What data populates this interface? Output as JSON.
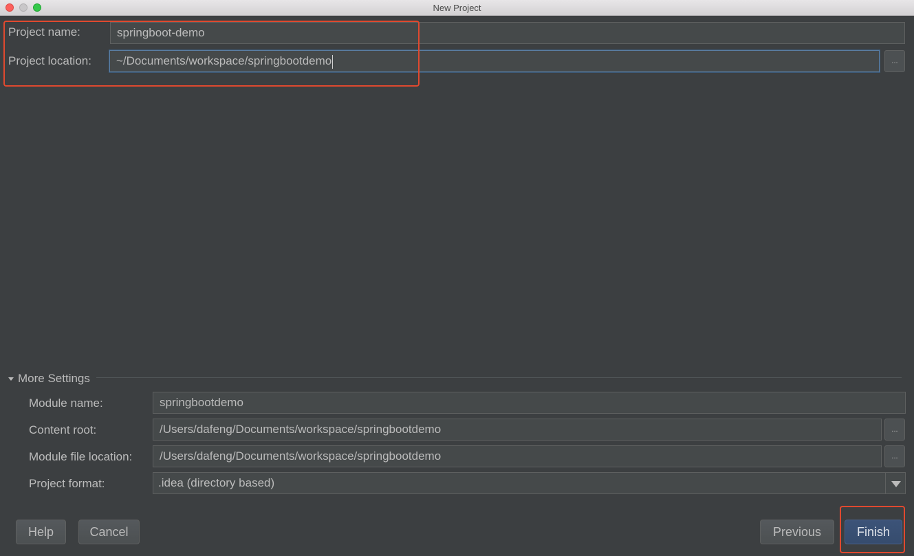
{
  "window": {
    "title": "New Project"
  },
  "project": {
    "name_label": "Project name:",
    "name_value": "springboot-demo",
    "location_label": "Project location:",
    "location_value": "~/Documents/workspace/springbootdemo",
    "browse_label": "..."
  },
  "more_settings": {
    "header": "More Settings",
    "module_name_label": "Module name:",
    "module_name_value": "springbootdemo",
    "content_root_label": "Content root:",
    "content_root_value": "/Users/dafeng/Documents/workspace/springbootdemo",
    "module_file_label": "Module file location:",
    "module_file_value": "/Users/dafeng/Documents/workspace/springbootdemo",
    "format_label": "Project format:",
    "format_value": ".idea (directory based)",
    "browse_label": "..."
  },
  "buttons": {
    "help": "Help",
    "cancel": "Cancel",
    "previous": "Previous",
    "finish": "Finish"
  },
  "colors": {
    "background": "#3c3f41",
    "field_bg": "#45494a",
    "highlight": "#e0492f",
    "primary_button": "#364c6e"
  }
}
